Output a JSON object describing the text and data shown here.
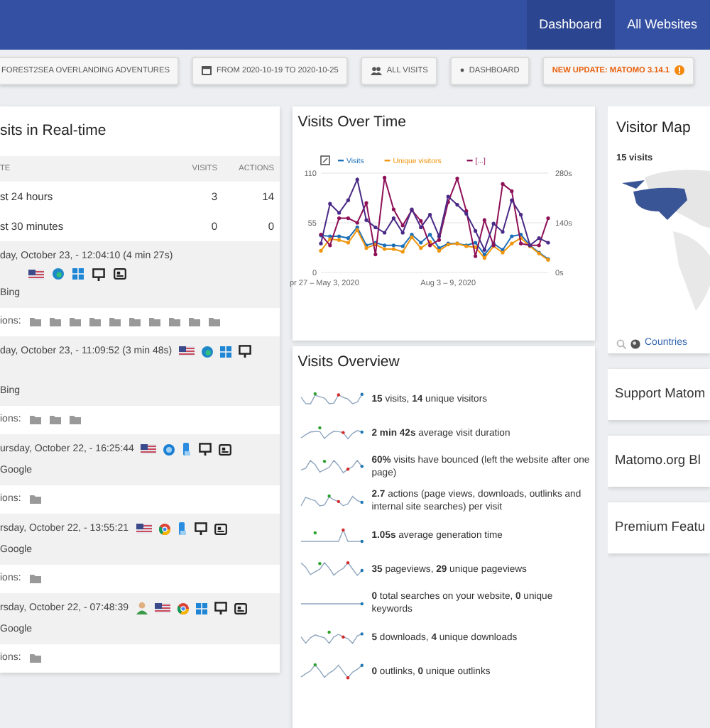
{
  "topbar": {
    "nav": [
      {
        "label": "Dashboard",
        "selected": true
      },
      {
        "label": "All Websites",
        "selected": false
      }
    ]
  },
  "toolbar": [
    {
      "kind": "site",
      "label": "FOREST2SEA OVERLANDING ADVENTURES"
    },
    {
      "kind": "date",
      "label": "FROM 2020-10-19 TO 2020-10-25"
    },
    {
      "kind": "segment",
      "label": "ALL VISITS"
    },
    {
      "kind": "dashboard",
      "label": "DASHBOARD"
    },
    {
      "kind": "update",
      "label": "NEW UPDATE: MATOMO 3.14.1"
    }
  ],
  "realtime": {
    "title": "sits in Real-time",
    "columns": [
      "TE",
      "VISITS",
      "ACTIONS"
    ],
    "rows": [
      [
        "st 24 hours",
        "3",
        "14"
      ],
      [
        "st 30 minutes",
        "0",
        "0"
      ]
    ],
    "visits": [
      {
        "time": "day, October 23, - 12:04:10 (4 min 27s)",
        "icons_inline": false,
        "icons": [
          {
            "kind": "flag"
          },
          {
            "kind": "edge"
          },
          {
            "kind": "windows"
          },
          {
            "kind": "monitor"
          },
          {
            "kind": "card"
          }
        ],
        "referrer": "Bing",
        "actions_label": "ions:",
        "actions": [
          {
            "kind": "folder"
          },
          {
            "kind": "folder"
          },
          {
            "kind": "folder"
          },
          {
            "kind": "folder"
          },
          {
            "kind": "folder"
          },
          {
            "kind": "folder"
          },
          {
            "kind": "folder"
          },
          {
            "kind": "folder"
          },
          {
            "kind": "folder"
          },
          {
            "kind": "folder"
          }
        ]
      },
      {
        "time": "day, October 23, - 11:09:52 (3 min 48s)",
        "icons_inline": true,
        "icons": [
          {
            "kind": "flag"
          },
          {
            "kind": "edge"
          },
          {
            "kind": "windows"
          },
          {
            "kind": "monitor"
          }
        ],
        "referrer": "Bing",
        "actions_label": "ions:",
        "actions": [
          {
            "kind": "folder"
          },
          {
            "kind": "folder"
          },
          {
            "kind": "folder"
          }
        ]
      },
      {
        "time": "ursday, October 22, - 16:25:44",
        "icons_inline": true,
        "icons": [
          {
            "kind": "flag"
          },
          {
            "kind": "globe"
          },
          {
            "kind": "tablet"
          },
          {
            "kind": "monitor"
          },
          {
            "kind": "card"
          }
        ],
        "referrer": "Google",
        "actions_label": "ions:",
        "actions": [
          {
            "kind": "folder"
          }
        ]
      },
      {
        "time": "rsday, October 22, - 13:55:21",
        "icons_inline": true,
        "icons": [
          {
            "kind": "flag"
          },
          {
            "kind": "chrome"
          },
          {
            "kind": "tablet"
          },
          {
            "kind": "monitor"
          },
          {
            "kind": "card"
          }
        ],
        "referrer": "Google",
        "actions_label": "ions:",
        "actions": [
          {
            "kind": "folder"
          }
        ]
      },
      {
        "time": "rsday, October 22, - 07:48:39",
        "icons_inline": true,
        "icons": [
          {
            "kind": "person"
          },
          {
            "kind": "flag"
          },
          {
            "kind": "chrome"
          },
          {
            "kind": "windows"
          },
          {
            "kind": "monitor"
          },
          {
            "kind": "card"
          }
        ],
        "referrer": "Google",
        "actions_label": "ions:",
        "actions": [
          {
            "kind": "folder"
          }
        ]
      }
    ]
  },
  "visits_over_time": {
    "title": "Visits Over Time",
    "right_axis_ticks": [
      "280s",
      "140s",
      "0s"
    ],
    "chart_data": {
      "type": "line",
      "legend": "top",
      "categories": [
        "pr 27 – May 3, 2020",
        null,
        null,
        null,
        null,
        null,
        null,
        null,
        null,
        null,
        null,
        null,
        null,
        null,
        "Aug 3 – 9, 2020",
        null,
        null,
        null,
        null,
        null,
        null,
        null,
        null,
        null,
        null,
        null
      ],
      "ylim": [
        0,
        110
      ],
      "yticks": [
        {
          "value": 0,
          "label": "0"
        },
        {
          "value": 55,
          "label": "55"
        },
        {
          "value": 110,
          "label": "110"
        }
      ],
      "series": [
        {
          "name": "Visits",
          "color": "#1d6fb8",
          "values": [
            41,
            40,
            40,
            38,
            50,
            30,
            33,
            30,
            30,
            29,
            42,
            33,
            42,
            27,
            32,
            32,
            30,
            33,
            20,
            32,
            25,
            40,
            42,
            30,
            22,
            15
          ]
        },
        {
          "name": "Unique visitors",
          "color": "#f0960e",
          "values": [
            24,
            37,
            36,
            33,
            47,
            27,
            31,
            26,
            26,
            23,
            39,
            27,
            34,
            24,
            31,
            32,
            29,
            28,
            16,
            29,
            22,
            32,
            38,
            29,
            21,
            14
          ]
        },
        {
          "name": "[...]",
          "color": "#8e1158",
          "values": [
            42,
            30,
            60,
            60,
            55,
            77,
            20,
            105,
            70,
            52,
            69,
            57,
            30,
            36,
            78,
            104,
            68,
            18,
            58,
            30,
            98,
            90,
            32,
            30,
            30,
            60
          ]
        },
        {
          "color": "#4a2a86",
          "values": [
            32,
            76,
            66,
            80,
            103,
            58,
            50,
            44,
            60,
            44,
            70,
            50,
            64,
            40,
            84,
            75,
            65,
            46,
            25,
            54,
            45,
            80,
            64,
            30,
            38,
            33
          ]
        }
      ]
    }
  },
  "visits_overview": {
    "title": "Visits Overview",
    "items": [
      {
        "text": "**15** visits, **14** unique visitors"
      },
      {
        "text": "**2 min 42s** average visit duration"
      },
      {
        "text": "**60%** visits have bounced (left the website after one page)"
      },
      {
        "text": "**2.7** actions (page views, downloads, outlinks and internal site searches) per visit"
      },
      {
        "text": "**1.05s** average generation time"
      },
      {
        "text": "**35** pageviews, **29** unique pageviews"
      },
      {
        "text": "**0** total searches on your website, **0** unique keywords"
      },
      {
        "text": "**5** downloads, **4** unique downloads"
      },
      {
        "text": "**0** outlinks, **0** unique outlinks"
      }
    ]
  },
  "visitor_map": {
    "title": "Visitor Map",
    "label": "15 visits",
    "link": "Countries"
  },
  "side_cards": [
    "Support Matom",
    "Matomo.org Bl",
    "Premium Featu"
  ]
}
